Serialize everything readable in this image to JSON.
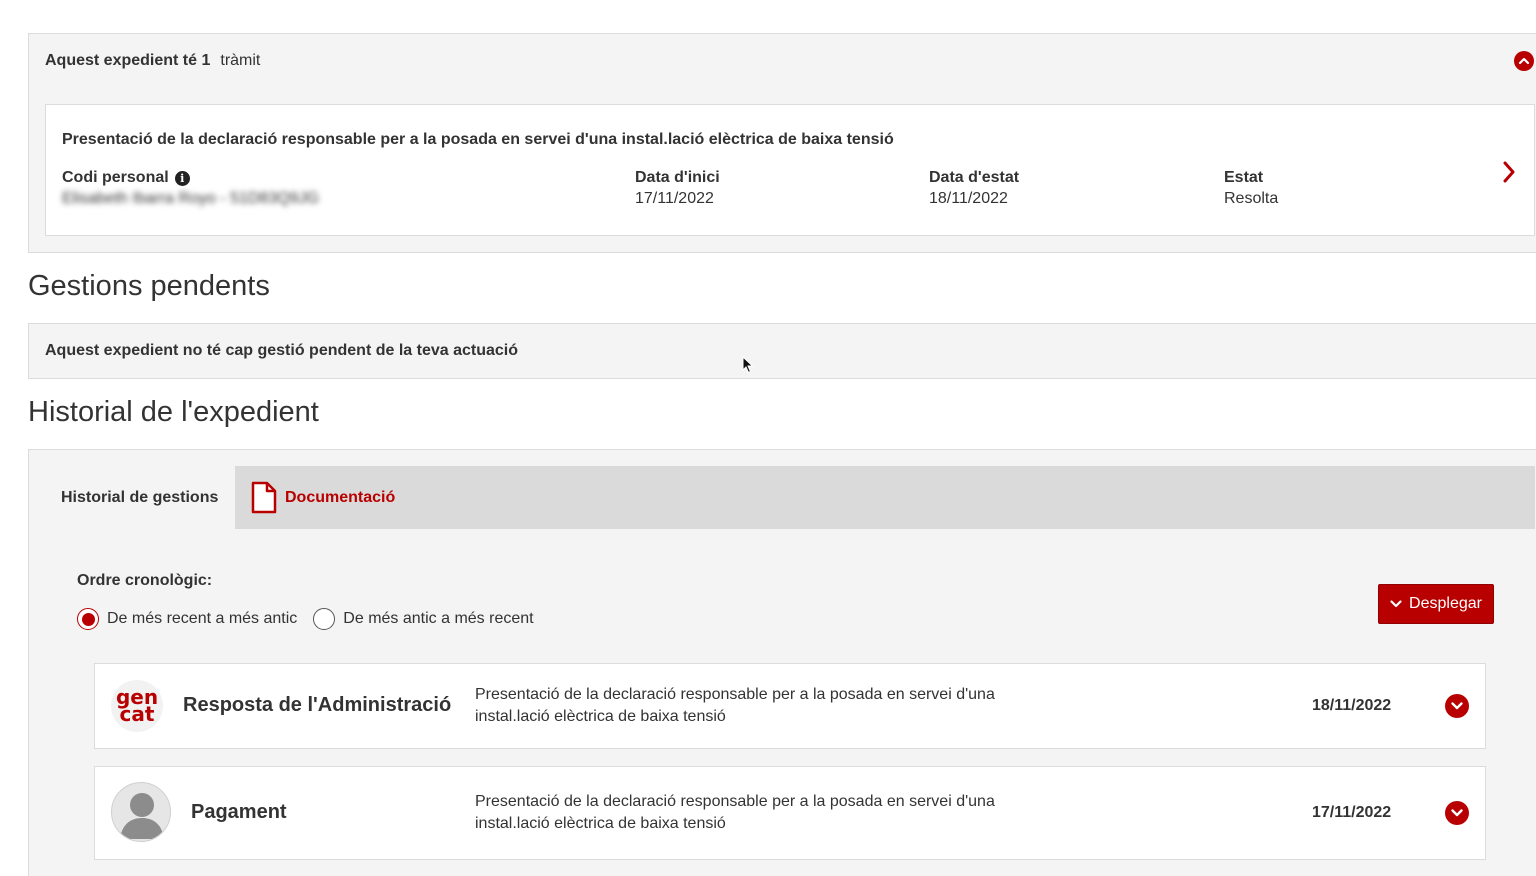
{
  "tramits": {
    "heading_bold": "Aquest expedient té 1",
    "heading_rest": "tràmit",
    "card": {
      "title": "Presentació de la declaració responsable per a la posada en servei d'una instal.lació elèctrica de baixa tensió",
      "codi_label": "Codi personal",
      "codi_value": "Elisabeth Ibarra Royo - 51D83Q9JG",
      "inici_label": "Data d'inici",
      "inici_value": "17/11/2022",
      "estat_date_label": "Data d'estat",
      "estat_date_value": "18/11/2022",
      "estat_label": "Estat",
      "estat_value": "Resolta"
    }
  },
  "pendents": {
    "title": "Gestions pendents",
    "message": "Aquest expedient no té cap gestió pendent de la teva actuació"
  },
  "historial": {
    "title": "Historial de l'expedient",
    "tabs": [
      {
        "label": "Historial de gestions"
      },
      {
        "label": "Documentació"
      }
    ],
    "order_label": "Ordre cronològic:",
    "order_options": [
      {
        "label": "De més recent a més antic",
        "checked": true
      },
      {
        "label": "De més antic a més recent",
        "checked": false
      }
    ],
    "expand_button": "Desplegar",
    "items": [
      {
        "logo_top": "gen",
        "logo_bottom": "cat",
        "title": "Resposta de l'Administració",
        "description": "Presentació de la declaració responsable per a la posada en servei d'una instal.lació elèctrica de baixa tensió",
        "date": "18/11/2022"
      },
      {
        "title": "Pagament",
        "description": "Presentació de la declaració responsable per a la posada en servei d'una instal.lació elèctrica de baixa tensió",
        "date": "17/11/2022"
      }
    ]
  },
  "colors": {
    "accent": "#b80000",
    "panel_bg": "#f4f4f4",
    "tab_bg": "#dadada"
  },
  "icons": [
    "chevron-up-icon",
    "info-icon",
    "chevron-right-icon",
    "document-icon",
    "chevron-down-icon",
    "user-avatar-icon",
    "mouse-cursor-icon"
  ]
}
